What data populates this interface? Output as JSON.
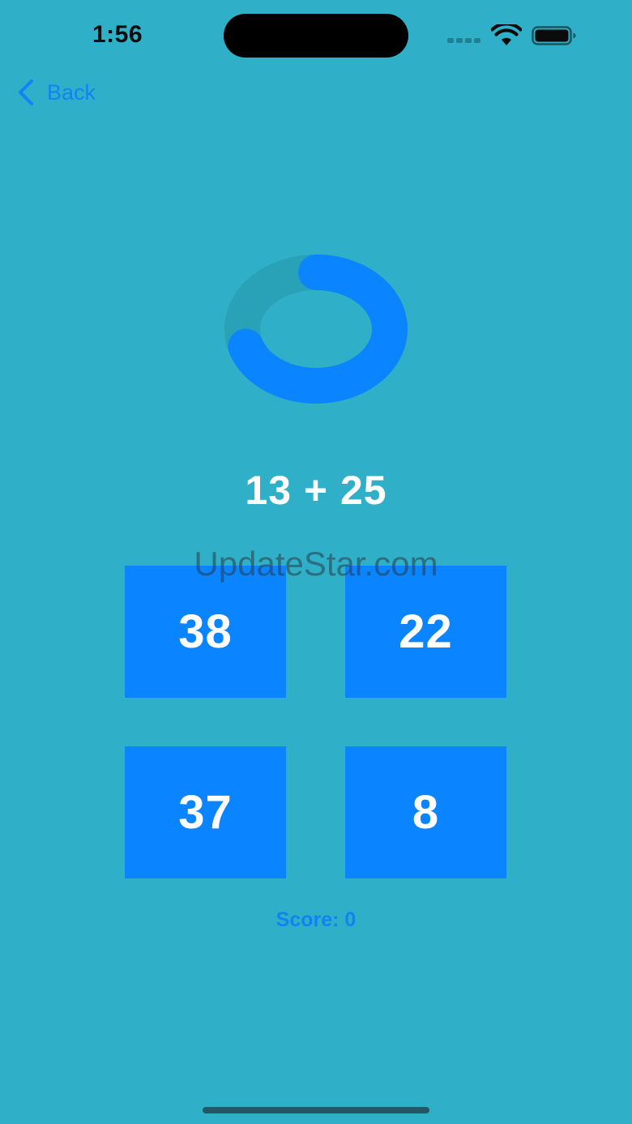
{
  "status_bar": {
    "time": "1:56",
    "icons": [
      "signal-icon",
      "wifi-icon",
      "battery-icon"
    ]
  },
  "nav": {
    "back_label": "Back",
    "back_icon": "chevron-left-icon"
  },
  "timer": {
    "remaining_fraction": 0.7
  },
  "question": {
    "text": "13 + 25"
  },
  "answers": [
    {
      "label": "38"
    },
    {
      "label": "22"
    },
    {
      "label": "37"
    },
    {
      "label": "8"
    }
  ],
  "score": {
    "text": "Score: 0"
  },
  "watermark": {
    "text": "UpdateStar.com"
  },
  "colors": {
    "background": "#2fb0c8",
    "accent": "#0a84ff",
    "ring_track": "#29a2b8",
    "text_light": "#ffffff"
  }
}
